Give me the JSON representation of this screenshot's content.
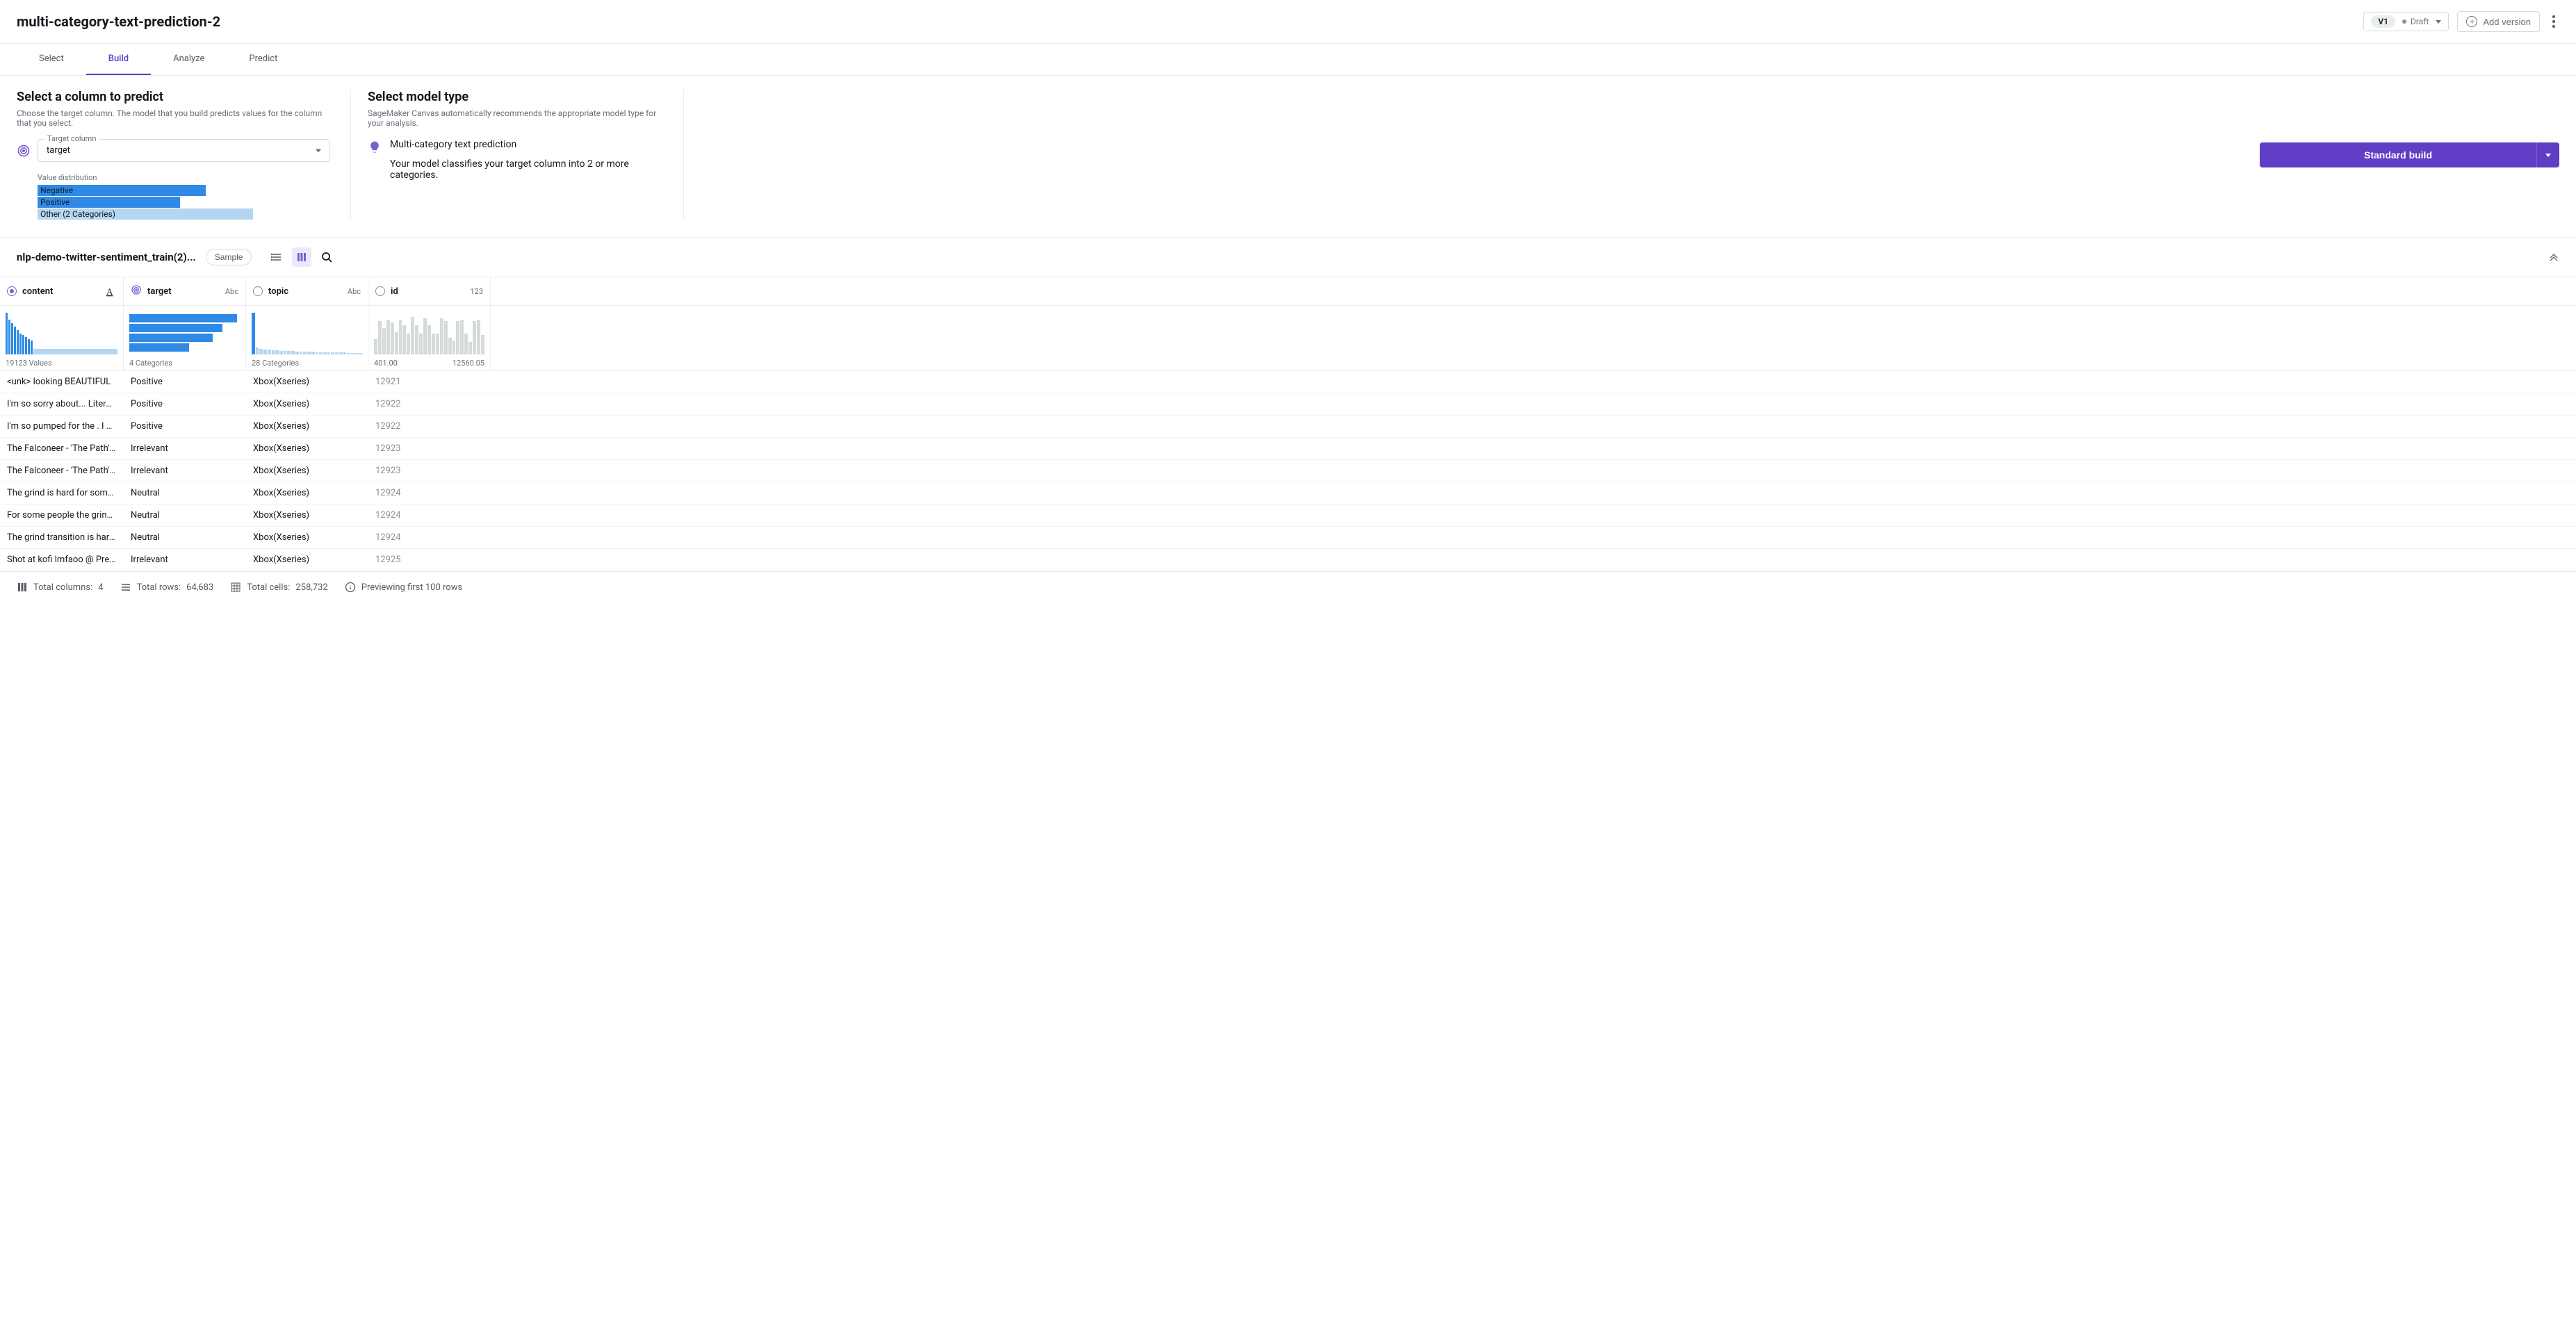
{
  "header": {
    "title": "multi-category-text-prediction-2",
    "version_badge": "V1",
    "status": "Draft",
    "add_version_label": "Add version"
  },
  "tabs": [
    "Select",
    "Build",
    "Analyze",
    "Predict"
  ],
  "active_tab_index": 1,
  "config": {
    "left_title": "Select a column to predict",
    "left_sub": "Choose the target column. The model that you build predicts values for the column that you select.",
    "target_label": "Target column",
    "target_value": "target",
    "dist_label": "Value distribution",
    "dist_bars": [
      {
        "label": "Negative",
        "width_pct": 78,
        "color": "#2e8ae6"
      },
      {
        "label": "Positive",
        "width_pct": 66,
        "color": "#2e8ae6"
      },
      {
        "label": "Other (2 Categories)",
        "width_pct": 100,
        "color": "#b5d6f2"
      }
    ],
    "mid_title": "Select model type",
    "mid_sub": "SageMaker Canvas automatically recommends the appropriate model type for your analysis.",
    "model_name": "Multi-category text prediction",
    "model_desc": "Your model classifies your target column into 2 or more categories.",
    "build_label": "Standard build"
  },
  "dataset": {
    "name": "nlp-demo-twitter-sentiment_train(2)...",
    "sample_label": "Sample"
  },
  "columns": [
    {
      "name": "content",
      "type_label": "A",
      "role": "text",
      "selected": true,
      "summary": "19123 Values",
      "target_icon": true,
      "spark_type": "tiny_bars"
    },
    {
      "name": "target",
      "type_label": "Abc",
      "role": "target",
      "selected": true,
      "summary": "4 Categories",
      "target_icon": true,
      "spark_type": "hbars"
    },
    {
      "name": "topic",
      "type_label": "Abc",
      "role": "cat",
      "selected": false,
      "summary": "28 Categories",
      "spark_type": "long_tail"
    },
    {
      "name": "id",
      "type_label": "123",
      "role": "num",
      "selected": false,
      "summary_left": "401.00",
      "summary_right": "12560.05",
      "spark_type": "histogram"
    }
  ],
  "chart_data": {
    "target_hbars": [
      155,
      134,
      120,
      86
    ],
    "topic_long_tail": [
      60,
      10,
      8,
      7,
      7,
      6,
      6,
      5,
      5,
      5,
      5,
      4,
      4,
      4,
      4,
      4,
      3,
      3,
      3,
      3,
      3,
      3,
      3,
      3,
      2,
      2,
      2,
      2
    ],
    "topic_long_tail_light_after_index": 1,
    "id_histogram": [
      22,
      48,
      38,
      50,
      46,
      32,
      50,
      42,
      30,
      54,
      42,
      30,
      52,
      42,
      30,
      30,
      52,
      48,
      24,
      20,
      48,
      50,
      30,
      18,
      48,
      50,
      28
    ],
    "content_tiny_bars": [
      60,
      50,
      45,
      40,
      35,
      30,
      28,
      25,
      22,
      20
    ]
  },
  "rows": [
    {
      "content": "<unk> looking BEAUTIFUL",
      "target": "Positive",
      "topic": "Xbox(Xseries)",
      "id": "12921"
    },
    {
      "content": "I'm so sorry about... Literally can...",
      "target": "Positive",
      "topic": "Xbox(Xseries)",
      "id": "12922"
    },
    {
      "content": "I'm so pumped for the . I Literall...",
      "target": "Positive",
      "topic": "Xbox(Xseries)",
      "id": "12922"
    },
    {
      "content": "The Falconeer - 'The Path' Game...",
      "target": "Irrelevant",
      "topic": "Xbox(Xseries)",
      "id": "12923"
    },
    {
      "content": "The Falconeer - 'The Path' Game...",
      "target": "Irrelevant",
      "topic": "Xbox(Xseries)",
      "id": "12923"
    },
    {
      "content": "The grind is hard for some folks ...",
      "target": "Neutral",
      "topic": "Xbox(Xseries)",
      "id": "12924"
    },
    {
      "content": "For some people the grind is eve...",
      "target": "Neutral",
      "topic": "Xbox(Xseries)",
      "id": "12924"
    },
    {
      "content": "The grind transition is hard for s...",
      "target": "Neutral",
      "topic": "Xbox(Xseries)",
      "id": "12924"
    },
    {
      "content": "Shot at kofi lmfaoo @ PressStar...",
      "target": "Irrelevant",
      "topic": "Xbox(Xseries)",
      "id": "12925"
    }
  ],
  "footer": {
    "total_columns_label": "Total columns:",
    "total_columns": "4",
    "total_rows_label": "Total rows:",
    "total_rows": "64,683",
    "total_cells_label": "Total cells:",
    "total_cells": "258,732",
    "preview_label": "Previewing first 100 rows"
  }
}
